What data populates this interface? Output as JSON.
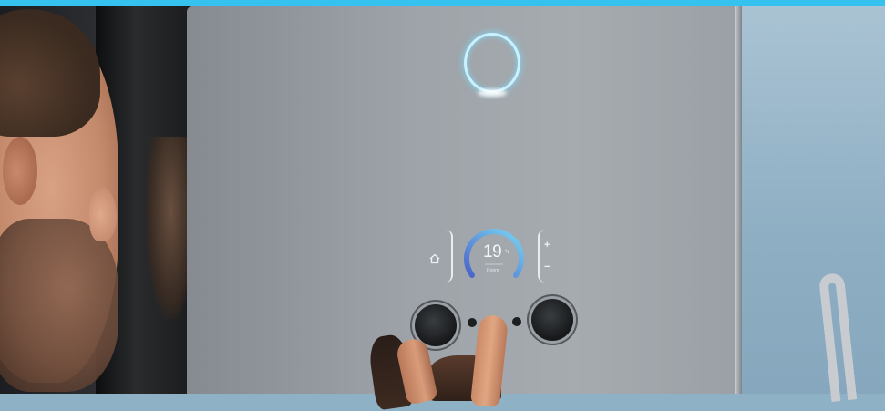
{
  "display": {
    "temperature": "19",
    "unit": "°c",
    "caption": "Room",
    "plus_symbol": "+",
    "minus_symbol": "−"
  },
  "icons": {
    "home": "home-icon",
    "ring": "status-ring-icon"
  },
  "colors": {
    "top_bar": "#36c2ee",
    "ring_glow": "#c9f1ff",
    "dial_gradient_start": "#5a78d6",
    "dial_gradient_end": "#6fd3f2"
  }
}
